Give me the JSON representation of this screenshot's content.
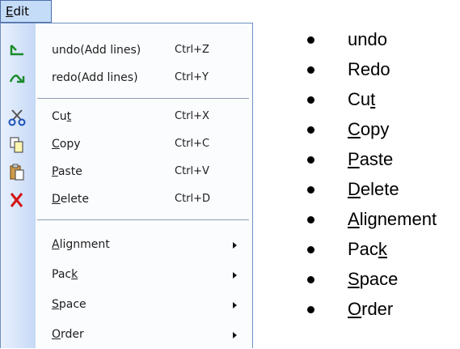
{
  "menu_bar": {
    "edit": {
      "pre": "",
      "mn": "E",
      "post": "dit"
    }
  },
  "menu_items": {
    "undo": {
      "label": "undo(Add lines)",
      "shortcut": "Ctrl+Z"
    },
    "redo": {
      "label": "redo(Add lines)",
      "shortcut": "Ctrl+Y"
    },
    "cut": {
      "pre": "Cu",
      "mn": "t",
      "post": "",
      "shortcut": "Ctrl+X"
    },
    "copy": {
      "pre": "",
      "mn": "C",
      "post": "opy",
      "shortcut": "Ctrl+C"
    },
    "paste": {
      "pre": "",
      "mn": "P",
      "post": "aste",
      "shortcut": "Ctrl+V"
    },
    "delete": {
      "pre": "",
      "mn": "D",
      "post": "elete",
      "shortcut": "Ctrl+D"
    },
    "alignment": {
      "pre": "",
      "mn": "A",
      "post": "lignment"
    },
    "pack": {
      "pre": "Pac",
      "mn": "k",
      "post": ""
    },
    "space": {
      "pre": "",
      "mn": "S",
      "post": "pace"
    },
    "order": {
      "pre": "",
      "mn": "O",
      "post": "rder"
    }
  },
  "bullets": [
    {
      "pre": "undo",
      "mn": "",
      "post": ""
    },
    {
      "pre": "Redo",
      "mn": "",
      "post": ""
    },
    {
      "pre": "Cu",
      "mn": "t",
      "post": ""
    },
    {
      "pre": "",
      "mn": "C",
      "post": "opy"
    },
    {
      "pre": "",
      "mn": "P",
      "post": "aste"
    },
    {
      "pre": "",
      "mn": "D",
      "post": "elete"
    },
    {
      "pre": "",
      "mn": "A",
      "post": "lignement"
    },
    {
      "pre": "Pac",
      "mn": "k",
      "post": ""
    },
    {
      "pre": "",
      "mn": "S",
      "post": "pace"
    },
    {
      "pre": "",
      "mn": "O",
      "post": "rder"
    }
  ],
  "colors": {
    "gutter": "#c6d9f6",
    "menu_border": "#6f8fbf",
    "title_bg": "#c5dcf8"
  }
}
